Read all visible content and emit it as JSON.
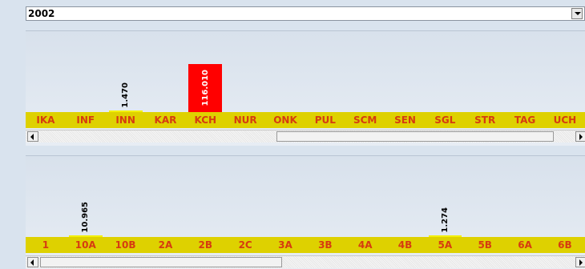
{
  "year_select": {
    "value": "2002"
  },
  "top_panel": {
    "categories": [
      "IKA",
      "INF",
      "INN",
      "KAR",
      "KCH",
      "NUR",
      "ONK",
      "PUL",
      "SCM",
      "SEN",
      "SGL",
      "STR",
      "TAG",
      "UCH"
    ],
    "bars": [
      {
        "category": "INN",
        "value": "1.470",
        "level": 0.03,
        "color": "#f3f000",
        "label_style": "above"
      },
      {
        "category": "KCH",
        "value": "116.010",
        "level": 1.0,
        "color": "#ff0000",
        "label_style": "inside"
      }
    ]
  },
  "bottom_panel": {
    "categories": [
      "1",
      "10A",
      "10B",
      "2A",
      "2B",
      "2C",
      "3A",
      "3B",
      "4A",
      "4B",
      "5A",
      "5B",
      "6A",
      "6B"
    ],
    "bars": [
      {
        "category": "10A",
        "value": "10.965",
        "level": 0.03,
        "color": "#f3f000",
        "label_style": "above"
      },
      {
        "category": "5A",
        "value": "1.274",
        "level": 0.02,
        "color": "#f3f000",
        "label_style": "above"
      }
    ]
  },
  "colors": {
    "strip": "#ded100",
    "category_text": "#d63b10",
    "background": "#d9e3ee"
  }
}
